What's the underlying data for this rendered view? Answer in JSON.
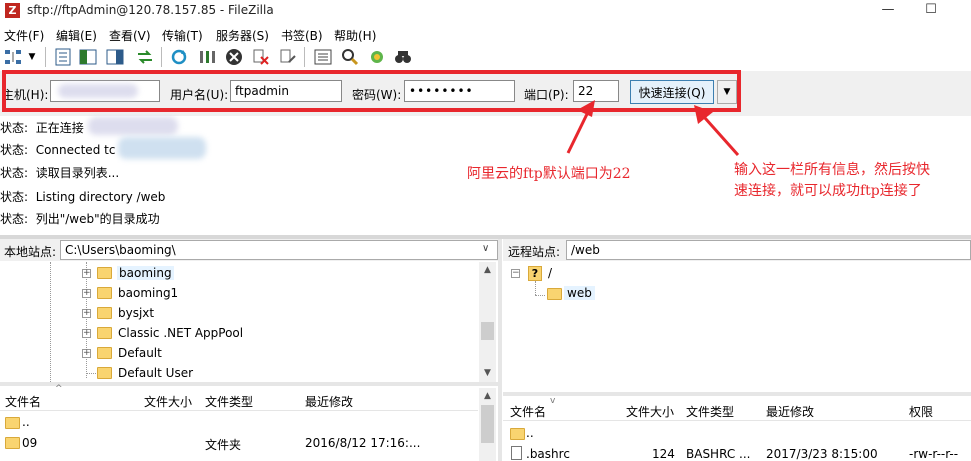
{
  "window": {
    "title": "sftp://ftpAdmin@120.78.157.85 - FileZilla",
    "minimize": "—",
    "maximize": "☐"
  },
  "menu": [
    "文件(F)",
    "编辑(E)",
    "查看(V)",
    "传输(T)",
    "服务器(S)",
    "书签(B)",
    "帮助(H)"
  ],
  "quickconnect": {
    "host_label": "主机(H):",
    "host_value": "",
    "user_label": "用户名(U):",
    "user_value": "ftpadmin",
    "pass_label": "密码(W):",
    "pass_value": "••••••••",
    "port_label": "端口(P):",
    "port_value": "22",
    "connect_label": "快速连接(Q)"
  },
  "log": [
    {
      "label": "状态:",
      "text": "正在连接"
    },
    {
      "label": "状态:",
      "text": "Connected tc"
    },
    {
      "label": "状态:",
      "text": "读取目录列表..."
    },
    {
      "label": "状态:",
      "text": "Listing directory /web"
    },
    {
      "label": "状态:",
      "text": "列出\"/web\"的目录成功"
    }
  ],
  "annotations": {
    "port_note": "阿里云的ftp默认端口为22",
    "connect_note_1": "输入这一栏所有信息，然后按快",
    "connect_note_2": "速连接，就可以成功ftp连接了"
  },
  "local": {
    "site_label": "本地站点:",
    "path": "C:\\Users\\baoming\\",
    "tree": [
      "baoming",
      "baoming1",
      "bysjxt",
      "Classic .NET AppPool",
      "Default",
      "Default User"
    ],
    "columns": [
      "文件名",
      "文件大小",
      "文件类型",
      "最近修改"
    ],
    "rows": [
      {
        "name": "..",
        "size": "",
        "type": "",
        "modified": ""
      },
      {
        "name": "09",
        "size": "",
        "type": "文件夹",
        "modified": "2016/8/12 17:16:..."
      }
    ]
  },
  "remote": {
    "site_label": "远程站点:",
    "path": "/web",
    "tree_root": "/",
    "tree_root_icon": "?",
    "tree_child": "web",
    "columns": [
      "文件名",
      "文件大小",
      "文件类型",
      "最近修改",
      "权限"
    ],
    "rows": [
      {
        "name": "..",
        "size": "",
        "type": "",
        "modified": "",
        "perm": ""
      },
      {
        "name": ".bashrc",
        "size": "124",
        "type": "BASHRC ...",
        "modified": "2017/3/23 8:15:00",
        "perm": "-rw-r--r--"
      }
    ]
  },
  "colors": {
    "highlight": "#e8272d",
    "folder": "#f9d470",
    "connect_bg": "#e5f1fb"
  },
  "icons": {
    "toolbar": [
      "site-manager-icon",
      "dropdown-icon",
      "toggle-log-icon",
      "toggle-local-tree-icon",
      "toggle-remote-tree-icon",
      "toggle-queue-icon",
      "refresh-icon",
      "process-queue-icon",
      "cancel-icon",
      "disconnect-icon",
      "reconnect-icon",
      "filter-icon",
      "search-icon",
      "compare-icon",
      "find-icon"
    ]
  }
}
